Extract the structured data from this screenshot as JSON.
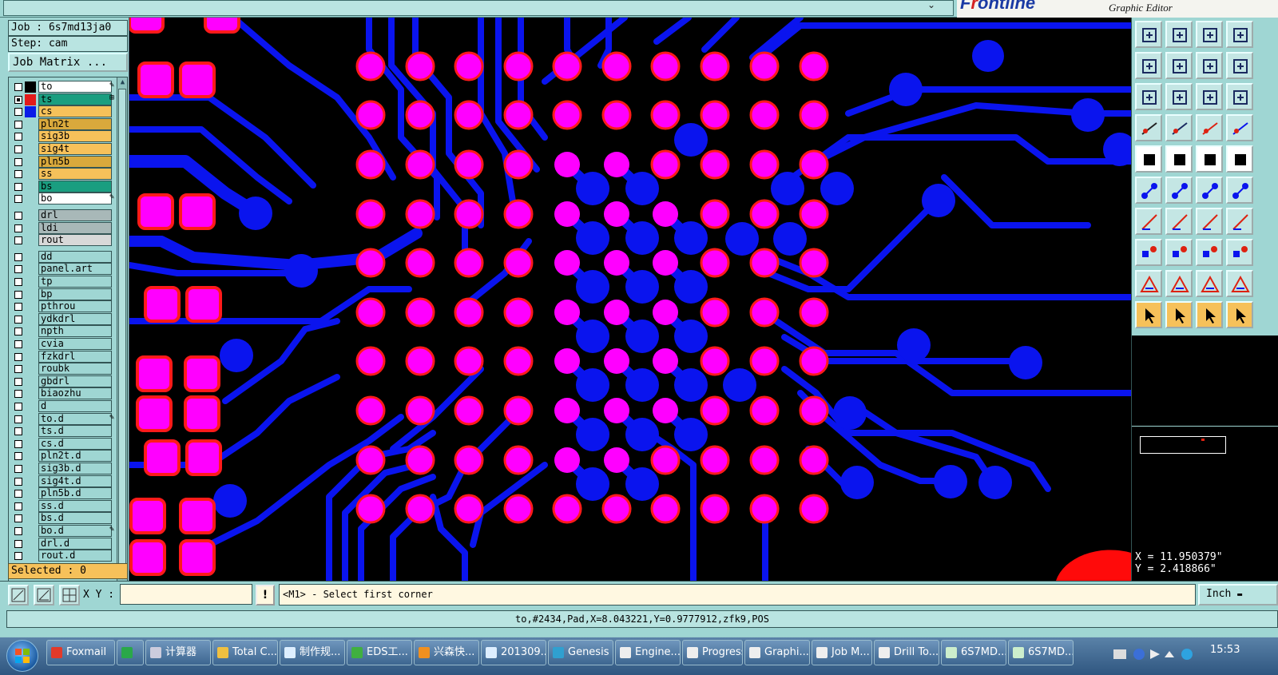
{
  "window": {
    "brand_prefix": "F",
    "brand_red": "r",
    "brand_rest": "ontline",
    "brand_subtitle": "Graphic Editor"
  },
  "job": {
    "job_label": "Job : 6s7md13ja0",
    "step_label": "Step: cam",
    "job_matrix_button": "Job Matrix ..."
  },
  "layers": [
    {
      "name": "to",
      "color": "#ffffff",
      "swatch": "#000000",
      "checked": false,
      "mark": "✎"
    },
    {
      "name": "ts",
      "color": "#1a9e80",
      "swatch": "#e21b1b",
      "checked": true,
      "mark": "⊞"
    },
    {
      "name": "cs",
      "color": "#f6c15a",
      "swatch": "#0a1ce8",
      "checked": false,
      "mark": ""
    },
    {
      "name": "pln2t",
      "color": "#d9a93c",
      "swatch": "",
      "checked": false,
      "mark": ""
    },
    {
      "name": "sig3b",
      "color": "#f6c15a",
      "swatch": "",
      "checked": false,
      "mark": ""
    },
    {
      "name": "sig4t",
      "color": "#f6c15a",
      "swatch": "",
      "checked": false,
      "mark": ""
    },
    {
      "name": "pln5b",
      "color": "#d9a93c",
      "swatch": "",
      "checked": false,
      "mark": ""
    },
    {
      "name": "ss",
      "color": "#f6c15a",
      "swatch": "",
      "checked": false,
      "mark": ""
    },
    {
      "name": "bs",
      "color": "#1a9e80",
      "swatch": "",
      "checked": false,
      "mark": ""
    },
    {
      "name": "bo",
      "color": "#ffffff",
      "swatch": "",
      "checked": false,
      "mark": "✎"
    },
    {
      "name": "drl",
      "color": "#a8b8b8",
      "swatch": "",
      "checked": false,
      "mark": "",
      "gap": true
    },
    {
      "name": "ldi",
      "color": "#a8b8b8",
      "swatch": "",
      "checked": false,
      "mark": ""
    },
    {
      "name": "rout",
      "color": "#d8d8d8",
      "swatch": "",
      "checked": false,
      "mark": ""
    },
    {
      "name": "dd",
      "color": "#9fd6d3",
      "swatch": "",
      "checked": false,
      "mark": "",
      "gap": true
    },
    {
      "name": "panel.art",
      "color": "#9fd6d3",
      "swatch": "",
      "checked": false,
      "mark": ""
    },
    {
      "name": "tp",
      "color": "#9fd6d3",
      "swatch": "",
      "checked": false,
      "mark": ""
    },
    {
      "name": "bp",
      "color": "#9fd6d3",
      "swatch": "",
      "checked": false,
      "mark": ""
    },
    {
      "name": "pthrou",
      "color": "#9fd6d3",
      "swatch": "",
      "checked": false,
      "mark": ""
    },
    {
      "name": "ydkdrl",
      "color": "#9fd6d3",
      "swatch": "",
      "checked": false,
      "mark": ""
    },
    {
      "name": "npth",
      "color": "#9fd6d3",
      "swatch": "",
      "checked": false,
      "mark": ""
    },
    {
      "name": "cvia",
      "color": "#9fd6d3",
      "swatch": "",
      "checked": false,
      "mark": ""
    },
    {
      "name": "fzkdrl",
      "color": "#9fd6d3",
      "swatch": "",
      "checked": false,
      "mark": ""
    },
    {
      "name": "roubk",
      "color": "#9fd6d3",
      "swatch": "",
      "checked": false,
      "mark": ""
    },
    {
      "name": "gbdrl",
      "color": "#9fd6d3",
      "swatch": "",
      "checked": false,
      "mark": ""
    },
    {
      "name": "biaozhu",
      "color": "#9fd6d3",
      "swatch": "",
      "checked": false,
      "mark": ""
    },
    {
      "name": "d",
      "color": "#9fd6d3",
      "swatch": "",
      "checked": false,
      "mark": ""
    },
    {
      "name": "to.d",
      "color": "#9fd6d3",
      "swatch": "",
      "checked": false,
      "mark": "✎"
    },
    {
      "name": "ts.d",
      "color": "#9fd6d3",
      "swatch": "",
      "checked": false,
      "mark": ""
    },
    {
      "name": "cs.d",
      "color": "#9fd6d3",
      "swatch": "",
      "checked": false,
      "mark": ""
    },
    {
      "name": "pln2t.d",
      "color": "#9fd6d3",
      "swatch": "",
      "checked": false,
      "mark": ""
    },
    {
      "name": "sig3b.d",
      "color": "#9fd6d3",
      "swatch": "",
      "checked": false,
      "mark": ""
    },
    {
      "name": "sig4t.d",
      "color": "#9fd6d3",
      "swatch": "",
      "checked": false,
      "mark": ""
    },
    {
      "name": "pln5b.d",
      "color": "#9fd6d3",
      "swatch": "",
      "checked": false,
      "mark": ""
    },
    {
      "name": "ss.d",
      "color": "#9fd6d3",
      "swatch": "",
      "checked": false,
      "mark": ""
    },
    {
      "name": "bs.d",
      "color": "#9fd6d3",
      "swatch": "",
      "checked": false,
      "mark": ""
    },
    {
      "name": "bo.d",
      "color": "#9fd6d3",
      "swatch": "",
      "checked": false,
      "mark": "✎"
    },
    {
      "name": "drl.d",
      "color": "#9fd6d3",
      "swatch": "",
      "checked": false,
      "mark": ""
    },
    {
      "name": "rout.d",
      "color": "#9fd6d3",
      "swatch": "",
      "checked": false,
      "mark": ""
    }
  ],
  "selected_label": "Selected : 0",
  "canvas": {
    "background": "#000000",
    "trace_color": "#0a14ee",
    "pad_color": "#ff00ff",
    "pad_ring_color": "#ff1a1a"
  },
  "toolbar_icons": [
    "zoom-home-icon",
    "zoom-back-icon",
    "home-icon",
    "zoom-window-icon",
    "pan-left-icon",
    "pan-right-icon",
    "zoom-fit-icon",
    "rotate-icon",
    "fit-all-icon",
    "fit-vertical-icon",
    "one-to-one-icon",
    "help-icon",
    "measure-tool-icon",
    "grid-icon",
    "snap-icon",
    "snap-alt-icon",
    "pad-icon",
    "polygon-icon",
    "ruler-icon",
    "circle-icon",
    "net-icon",
    "delete-icon",
    "line-add-icon",
    "line-alt-icon",
    "line-red-icon",
    "line-blue-icon",
    "arc-icon",
    "flip-icon",
    "pad-add-icon",
    "split-icon",
    "resize-icon",
    "copy-icon",
    "triangle-icon",
    "triangle-a-icon",
    "triangle-text-icon",
    "triangle-alt-icon",
    "select-pointer-icon",
    "select-box-icon",
    "select-shape-icon",
    "select-net-icon"
  ],
  "coords": {
    "x": "X = 11.950379\"",
    "y": "Y = 2.418866\""
  },
  "command": {
    "xy_label": "X Y :",
    "xy_value": "",
    "excl": "!",
    "prompt": "<M1> - Select first corner",
    "unit": "Inch"
  },
  "status_line": "to,#2434,Pad,X=8.043221,Y=0.9777912,zfk9,POS",
  "taskbar": {
    "items": [
      {
        "label": "Foxmail",
        "color": "#e23a2a"
      },
      {
        "label": "",
        "color": "#2aa84a"
      },
      {
        "label": "计算器",
        "color": "#ccccdd"
      },
      {
        "label": "Total C...",
        "color": "#f0c040"
      },
      {
        "label": "制作规...",
        "color": "#ddeeff"
      },
      {
        "label": "EDS工...",
        "color": "#40b040"
      },
      {
        "label": "兴森快...",
        "color": "#f09020"
      },
      {
        "label": "201309...",
        "color": "#ddeeff"
      },
      {
        "label": "Genesis",
        "color": "#30a0d0"
      },
      {
        "label": "Engine...",
        "color": "#eeeeee"
      },
      {
        "label": "Progress",
        "color": "#eeeeee"
      },
      {
        "label": "Graphi...",
        "color": "#eeeeee"
      },
      {
        "label": "Job M...",
        "color": "#eeeeee"
      },
      {
        "label": "Drill To...",
        "color": "#eeeeee"
      },
      {
        "label": "6S7MD...",
        "color": "#cceecc"
      },
      {
        "label": "6S7MD...",
        "color": "#cceecc"
      }
    ],
    "clock": "15:53"
  }
}
